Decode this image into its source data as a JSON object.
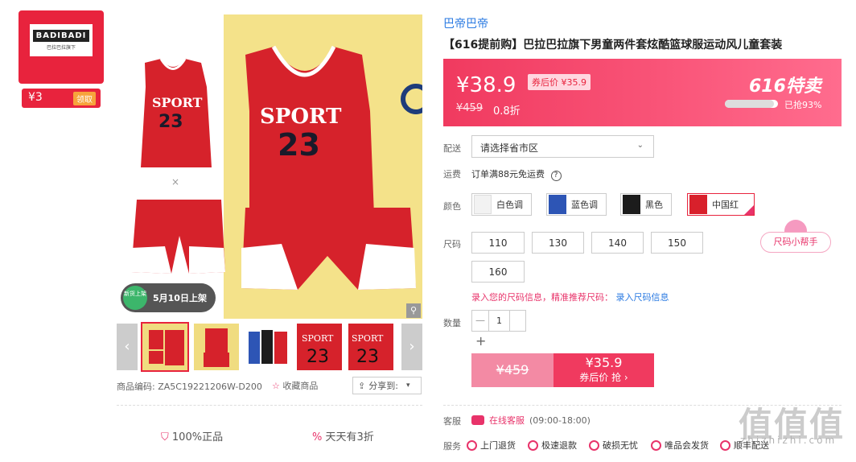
{
  "store": {
    "logo_text": "BADIBADI",
    "logo_sub": "巴拉巴拉旗下",
    "coupon_amount": "¥3",
    "coupon_action": "领取"
  },
  "gallery": {
    "launch_badge": "新货上架",
    "launch_text": "5月10日上架",
    "prev_icon": "chevron-left-icon",
    "next_icon": "chevron-right-icon",
    "zoom_icon": "magnifier-icon",
    "thumb_count": 6,
    "selected_thumb": 1
  },
  "product_meta": {
    "sku_label": "商品编码:",
    "sku": "ZA5C19221206W-D200",
    "favorite": "收藏商品",
    "share": "分享到:"
  },
  "guarantees": {
    "authentic": "100%正品",
    "discount": "天天有3折"
  },
  "product": {
    "brand": "巴帝巴帝",
    "title": "【616提前购】巴拉巴拉旗下男童两件套炫酷篮球服运动风儿童套装"
  },
  "price": {
    "current": "¥38.9",
    "after_coupon": "券后价 ¥35.9",
    "original": "¥459",
    "discount": "0.8折",
    "promo": "616特卖",
    "sold": "已抢93%",
    "sold_fraction": 0.93
  },
  "labels": {
    "delivery": "配送",
    "shipping": "运费",
    "color": "颜色",
    "size": "尺码",
    "quantity": "数量",
    "service": "客服",
    "guarantee": "服务"
  },
  "delivery": {
    "placeholder": "请选择省市区"
  },
  "shipping": {
    "text": "订单满88元免运费"
  },
  "colors": [
    {
      "label": "白色调",
      "swatch": "#f2f2f2"
    },
    {
      "label": "蓝色调",
      "swatch": "#2d55b5"
    },
    {
      "label": "黑色",
      "swatch": "#1c1c1c"
    },
    {
      "label": "中国红",
      "swatch": "#d8202b",
      "selected": true
    }
  ],
  "sizes": [
    "110",
    "130",
    "140",
    "150",
    "160"
  ],
  "size_helper": "尺码小帮手",
  "size_note": {
    "text": "录入您的尺码信息，精准推荐尺码：",
    "link": "录入尺码信息"
  },
  "quantity": {
    "value": "1",
    "minus": "—",
    "plus": "+"
  },
  "buy": {
    "orig_price": "¥459",
    "coupon_price": "¥35.9",
    "coupon_text": "券后价 抢 ›"
  },
  "customer_service": {
    "link": "在线客服",
    "hours": "(09:00-18:00)"
  },
  "services": [
    "上门退货",
    "极速退款",
    "破损无忧",
    "唯品会发货",
    "顺丰配送"
  ],
  "watermark": {
    "text": "值值值",
    "url": "zhizhizhi.com"
  }
}
